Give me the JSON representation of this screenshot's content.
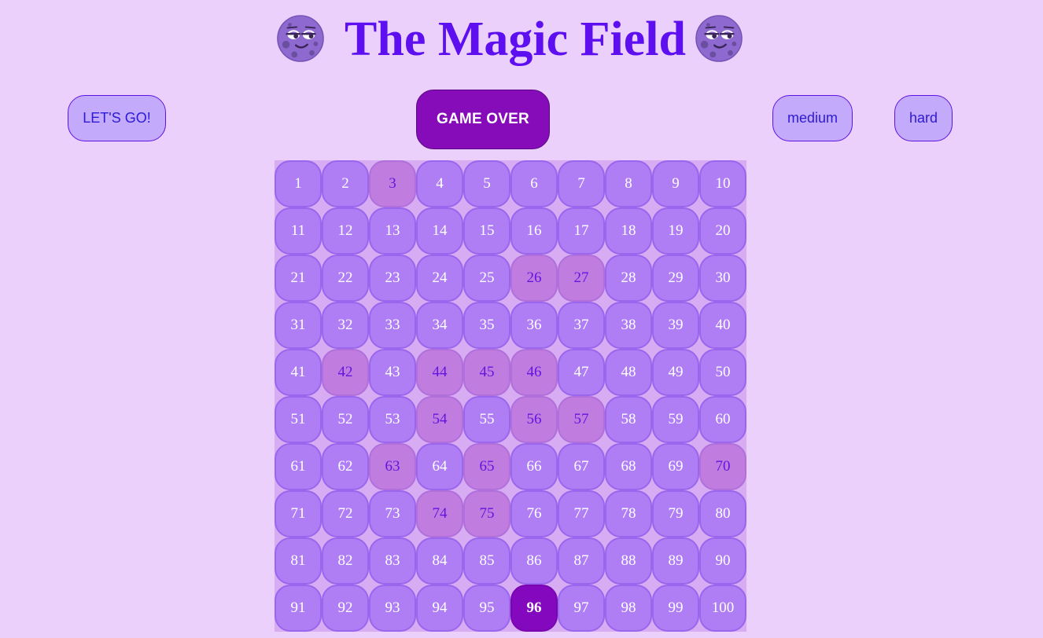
{
  "header": {
    "title": "The Magic Field",
    "left_icon": "moon-face-icon",
    "right_icon": "moon-face-icon"
  },
  "controls": {
    "start_label": "LET'S GO!",
    "status_label": "GAME OVER",
    "medium_label": "medium",
    "hard_label": "hard"
  },
  "board": {
    "rows": 10,
    "cols": 10,
    "cells": [
      "1",
      "2",
      "3",
      "4",
      "5",
      "6",
      "7",
      "8",
      "9",
      "10",
      "11",
      "12",
      "13",
      "14",
      "15",
      "16",
      "17",
      "18",
      "19",
      "20",
      "21",
      "22",
      "23",
      "24",
      "25",
      "26",
      "27",
      "28",
      "29",
      "30",
      "31",
      "32",
      "33",
      "34",
      "35",
      "36",
      "37",
      "38",
      "39",
      "40",
      "41",
      "42",
      "43",
      "44",
      "45",
      "46",
      "47",
      "48",
      "49",
      "50",
      "51",
      "52",
      "53",
      "54",
      "55",
      "56",
      "57",
      "58",
      "59",
      "60",
      "61",
      "62",
      "63",
      "64",
      "65",
      "66",
      "67",
      "68",
      "69",
      "70",
      "71",
      "72",
      "73",
      "74",
      "75",
      "76",
      "77",
      "78",
      "79",
      "80",
      "81",
      "82",
      "83",
      "84",
      "85",
      "86",
      "87",
      "88",
      "89",
      "90",
      "91",
      "92",
      "93",
      "94",
      "95",
      "96",
      "97",
      "98",
      "99",
      "100"
    ],
    "revealed": [
      3,
      26,
      27,
      42,
      44,
      45,
      46,
      54,
      56,
      57,
      63,
      65,
      70,
      74,
      75
    ],
    "current": 96
  },
  "colors": {
    "background": "#ebd0fc",
    "title": "#5d0ff0",
    "cell": "#af7ef4",
    "cell_revealed": "#c07ddf",
    "cell_current": "#8408bd",
    "status_button": "#850cb8",
    "light_button": "#c4aafb"
  }
}
